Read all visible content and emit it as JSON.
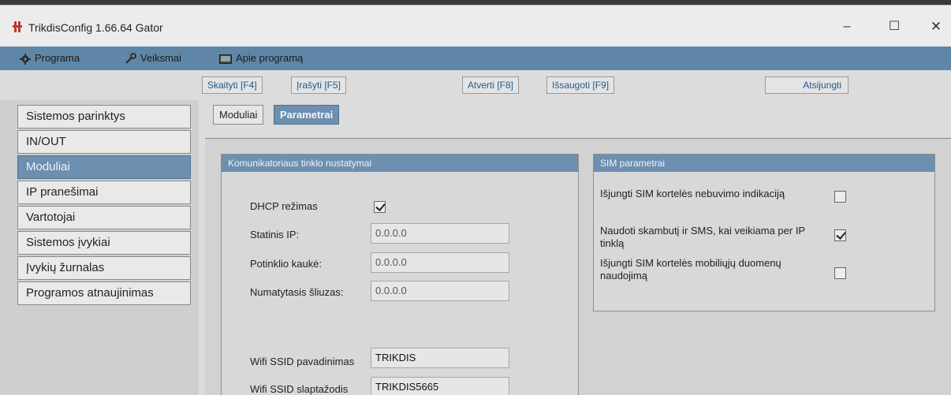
{
  "window": {
    "title": "TrikdisConfig 1.66.64   Gator",
    "controls": {
      "minimize": "–",
      "maximize": "☐",
      "close": "✕"
    }
  },
  "menu": [
    {
      "label": "Programa",
      "icon": "gear-icon"
    },
    {
      "label": "Veiksmai",
      "icon": "wrench-icon"
    },
    {
      "label": "Apie programą",
      "icon": "monitor-icon"
    }
  ],
  "toolbar": {
    "read": "Skaityti [F4]",
    "write": "Įrašyti [F5]",
    "open": "Atverti [F8]",
    "save": "Išsaugoti [F9]",
    "disconnect": "Atsijungti"
  },
  "sidebar": {
    "items": [
      {
        "label": "Sistemos parinktys"
      },
      {
        "label": "IN/OUT"
      },
      {
        "label": "Moduliai"
      },
      {
        "label": "IP pranešimai"
      },
      {
        "label": "Vartotojai"
      },
      {
        "label": "Sistemos įvykiai"
      },
      {
        "label": "Įvykių žurnalas"
      },
      {
        "label": "Programos atnaujinimas"
      }
    ],
    "active": "Moduliai"
  },
  "tabs": {
    "modules": "Moduliai",
    "params": "Parametrai",
    "active": "Parametrai"
  },
  "network_panel": {
    "title": "Komunikatoriaus tinklo nustatymai",
    "dhcp_label": "DHCP režimas",
    "dhcp_checked": true,
    "static_ip_label": "Statinis IP:",
    "static_ip": "0.0.0.0",
    "subnet_label": "Potinklio kaukė:",
    "subnet": "0.0.0.0",
    "gateway_label": "Numatytasis šliuzas:",
    "gateway": "0.0.0.0",
    "ssid_label": "Wifi SSID pavadinimas",
    "ssid": "TRIKDIS",
    "password_label": "Wifi SSID slaptažodis",
    "password": "TRIKDIS5665"
  },
  "sim_panel": {
    "title": "SIM parametrai",
    "opt1_label": "Išjungti SIM kortelės nebuvimo indikaciją",
    "opt1_checked": false,
    "opt2_label": "Naudoti skambutį ir SMS, kai veikiama per IP tinklą",
    "opt2_checked": true,
    "opt3_label": "Išjungti SIM kortelės mobiliųjų duomenų naudojimą",
    "opt3_checked": false
  },
  "colors": {
    "accent": "#6d8fb0",
    "menubar": "#5f86a6",
    "toolbar_text": "#1f5a8a"
  }
}
